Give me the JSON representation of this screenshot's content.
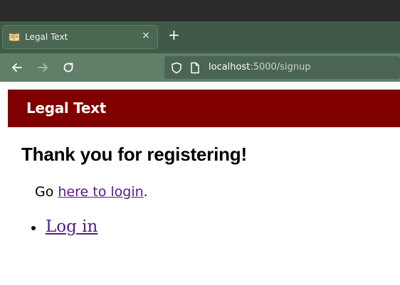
{
  "browser": {
    "tab": {
      "title": "Legal Text",
      "favicon": "open-book-icon",
      "close_glyph": "×"
    },
    "new_tab_glyph": "+",
    "url": {
      "host": "localhost",
      "rest": ":5000/signup"
    }
  },
  "site": {
    "title": "Legal Text",
    "header_color": "#800000"
  },
  "content": {
    "heading": "Thank you for registering!",
    "go_prefix": "Go ",
    "here_link": "here to login",
    "go_suffix": ".",
    "list": [
      {
        "label": "Log in"
      }
    ]
  },
  "colors": {
    "link": "#551a8b",
    "tab_bar": "#3f5b47",
    "nav_bar": "#5f7f68"
  }
}
